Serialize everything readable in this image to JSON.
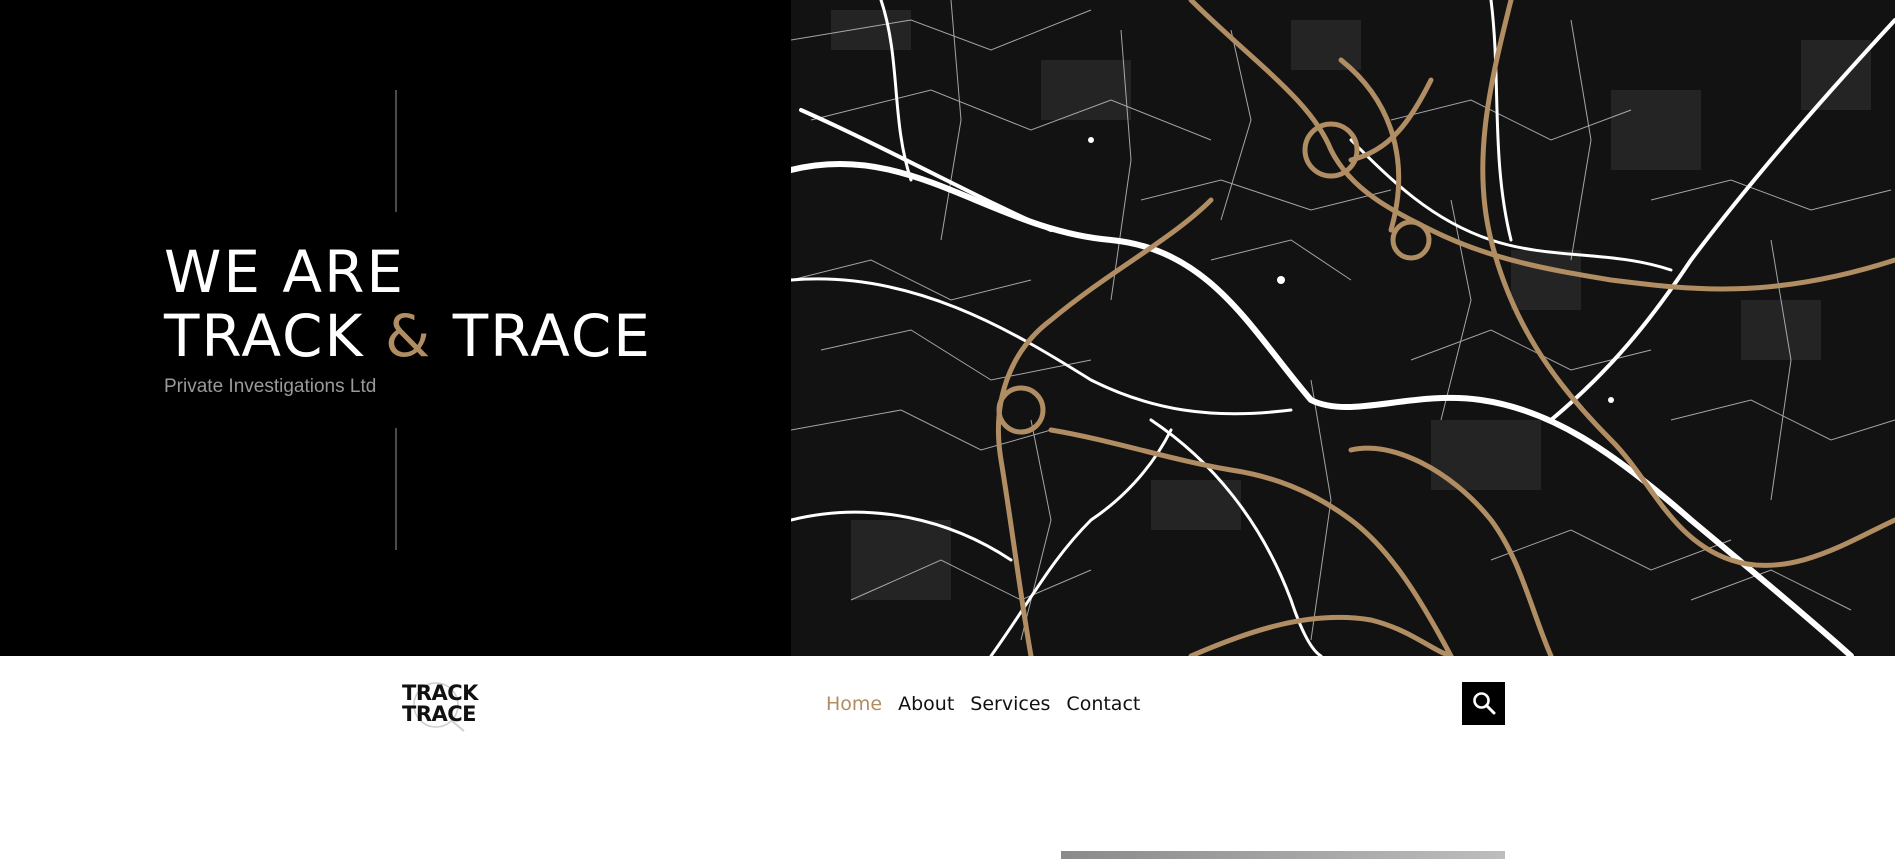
{
  "hero": {
    "headline_line1": "WE ARE",
    "headline_word_a": "TRACK",
    "headline_amp": "&",
    "headline_word_b": "TRACE",
    "subtitle": "Private Investigations Ltd"
  },
  "logo": {
    "line1": "TRACK",
    "line2": "TRACE"
  },
  "nav": {
    "items": [
      {
        "label": "Home",
        "active": true
      },
      {
        "label": "About",
        "active": false
      },
      {
        "label": "Services",
        "active": false
      },
      {
        "label": "Contact",
        "active": false
      }
    ]
  },
  "icons": {
    "search": "search-icon"
  },
  "colors": {
    "accent": "#b08d62",
    "background_dark": "#000000",
    "map_background": "#111111",
    "text_dark": "#111111"
  }
}
